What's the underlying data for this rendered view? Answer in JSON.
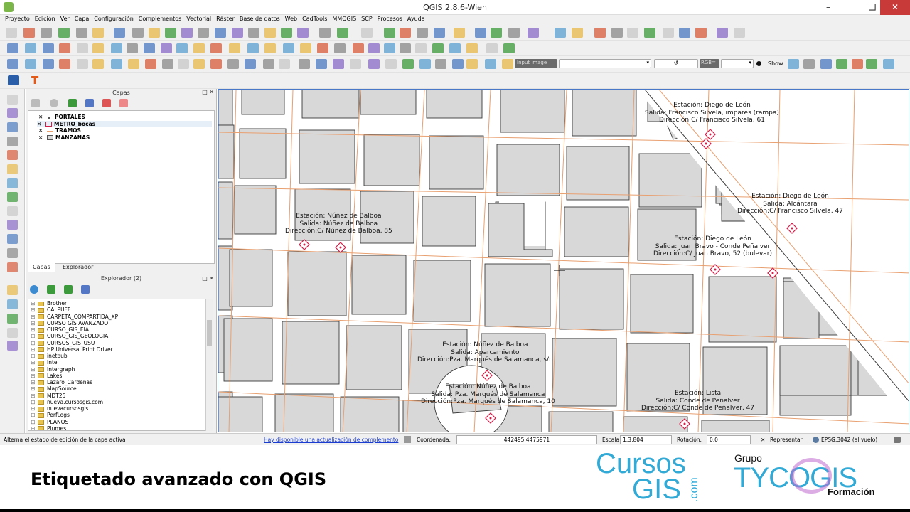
{
  "window": {
    "title": "QGIS 2.8.6-Wien"
  },
  "menu": [
    "Proyecto",
    "Edición",
    "Ver",
    "Capa",
    "Configuración",
    "Complementos",
    "Vectorial",
    "Ráster",
    "Base de datos",
    "Web",
    "CadTools",
    "MMQGIS",
    "SCP",
    "Procesos",
    "Ayuda"
  ],
  "raster_toolbar": {
    "input_label": "Input image",
    "rgb_label": "RGB=",
    "show_label": "Show"
  },
  "layers_panel": {
    "title": "Capas",
    "layers": [
      {
        "name": "PORTALES",
        "checked": true
      },
      {
        "name": "METRO_bocas",
        "checked": true
      },
      {
        "name": "TRAMOS",
        "checked": true
      },
      {
        "name": "MANZANAS",
        "checked": true
      }
    ],
    "tabs": [
      "Capas",
      "Explorador"
    ]
  },
  "browser_panel": {
    "title": "Explorador (2)",
    "items": [
      "Brother",
      "CALPUFF",
      "CARPETA_COMPARTIDA_XP",
      "CURSO GIS AVANZADO",
      "CURSO_GIS_EIA",
      "CURSO_GIS_GEOLOGIA",
      "CURSOS_GIS_USU",
      "HP Universal Print Driver",
      "inetpub",
      "Intel",
      "Intergraph",
      "Lakes",
      "Lazaro_Cardenas",
      "MapSource",
      "MDT25",
      "nueva.cursosgis.com",
      "nuevacursosgis",
      "PerfLogs",
      "PLANOS",
      "Plumes"
    ]
  },
  "map_labels": [
    {
      "id": "diego-leon-1",
      "lines": [
        "Estación: Diego de León",
        "Salida: Francisco Silvela, impares (rampa)",
        "Dirección:C/ Francisco Silvela, 61"
      ]
    },
    {
      "id": "diego-leon-2",
      "lines": [
        "Estación: Diego de León",
        "Salida: Alcántara",
        "Dirección:C/ Francisco Silvela, 47"
      ]
    },
    {
      "id": "diego-leon-3",
      "lines": [
        "Estación: Diego de León",
        "Salida: Juan Bravo - Conde Peñalver",
        "Dirección:C/ Juan Bravo, 52 (bulevar)"
      ]
    },
    {
      "id": "nunez-balboa-1",
      "lines": [
        "Estación: Núñez de Balboa",
        "Salida: Núñez de Balboa",
        "Dirección:C/ Núñez de Balboa, 85"
      ]
    },
    {
      "id": "nunez-balboa-2",
      "lines": [
        "Estación: Núñez de Balboa",
        "Salida: Aparcamiento",
        "Dirección:Pza. Marqués de Salamanca, s/n"
      ]
    },
    {
      "id": "nunez-balboa-3",
      "lines": [
        "Estación: Núñez de Balboa",
        "Salida: Pza. Marqués de Salamanca",
        "Dirección:Pza. Marqués de Salamanca, 10"
      ]
    },
    {
      "id": "lista",
      "lines": [
        "Estación: Lista",
        "Salida: Conde de Peñalver",
        "Dirección:C/ Conde de Peñalver, 47"
      ]
    }
  ],
  "status_bar": {
    "message": "Alterna el estado de edición de la capa activa",
    "update_link": "Hay disponible una actualización de complemento",
    "coord_label": "Coordenada:",
    "coord_value": "442495,4475971",
    "scale_label": "Escala",
    "scale_value": "1:3,804",
    "rotation_label": "Rotación:",
    "rotation_value": "0,0",
    "render_label": "Representar",
    "crs_label": "EPSG:3042 (al vuelo)"
  },
  "footer": {
    "title": "Etiquetado avanzado con QGIS",
    "logo1_line1": "Cursos",
    "logo1_line2": "GIS",
    "logo1_suffix": ".com",
    "logo2_grupo": "Grupo",
    "logo2_name": "TYCOGIS",
    "logo2_sub": "Formación"
  },
  "colors": {
    "block_fill": "#d8d8d8",
    "block_stroke": "#3a3a3a",
    "street_line": "#e8a070",
    "metro_marker": "#d0204a",
    "logo_blue": "#33aad6"
  }
}
